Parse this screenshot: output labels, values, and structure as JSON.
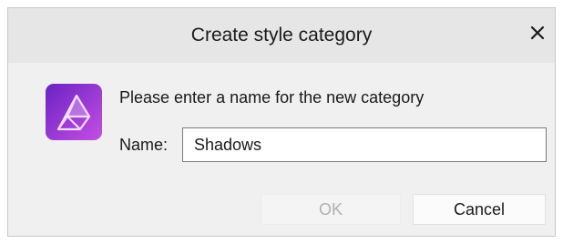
{
  "dialog": {
    "title": "Create style category",
    "close_icon": "close-icon",
    "app_icon": "affinity-photo-icon",
    "prompt": "Please enter a name for the new category",
    "name_label": "Name:",
    "name_value": "Shadows",
    "ok_label": "OK",
    "cancel_label": "Cancel",
    "ok_enabled": false
  },
  "colors": {
    "app_icon_gradient_start": "#7b2fd0",
    "app_icon_gradient_end": "#c04fe0",
    "titlebar_bg": "#e6e6e6",
    "dialog_bg": "#f0f0f0"
  }
}
